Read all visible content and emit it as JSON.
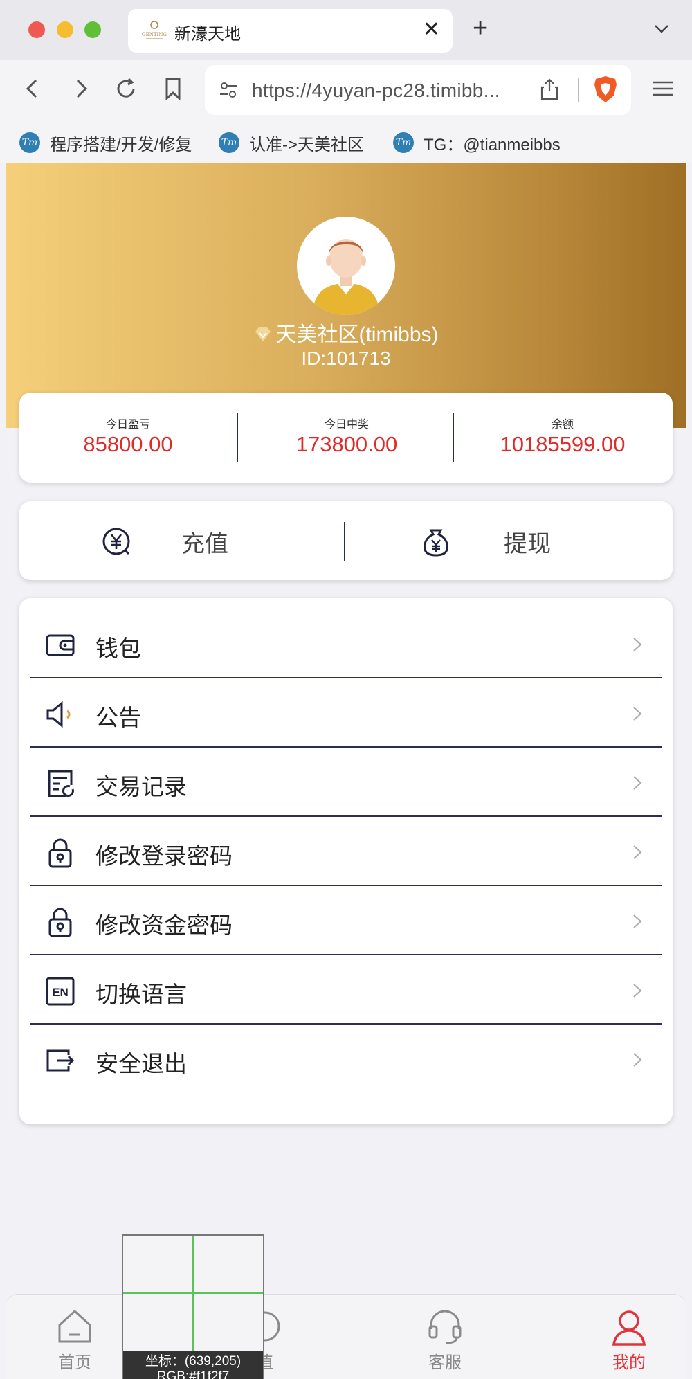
{
  "browser": {
    "tab_title": "新濠天地",
    "url": "https://4yuyan-pc28.timibb...",
    "bookmarks": [
      {
        "label": "程序搭建/开发/修复",
        "icon": "tm-icon"
      },
      {
        "label": "认准->天美社区",
        "icon": "tm-icon"
      },
      {
        "label": "TG：@tianmeibbs",
        "icon": "tm-icon"
      }
    ],
    "tab_logo_text": "GENTING",
    "bookmark_icon_text": "Tm"
  },
  "profile": {
    "name": "天美社区(timibbs)",
    "id": "ID:101713"
  },
  "stats": [
    {
      "label": "今日盈亏",
      "value": "85800.00"
    },
    {
      "label": "今日中奖",
      "value": "173800.00"
    },
    {
      "label": "余额",
      "value": "10185599.00"
    }
  ],
  "actions": {
    "recharge": "充值",
    "withdraw": "提现"
  },
  "menu": [
    {
      "label": "钱包",
      "icon": "wallet-icon"
    },
    {
      "label": "公告",
      "icon": "speaker-icon"
    },
    {
      "label": "交易记录",
      "icon": "transaction-record-icon"
    },
    {
      "label": "修改登录密码",
      "icon": "lock-icon"
    },
    {
      "label": "修改资金密码",
      "icon": "lock-icon"
    },
    {
      "label": "切换语言",
      "icon": "language-en-icon"
    },
    {
      "label": "安全退出",
      "icon": "logout-icon"
    }
  ],
  "language_icon_text": "EN",
  "bottom_nav": [
    {
      "label": "首页",
      "icon": "home-icon",
      "active": false
    },
    {
      "label": "值",
      "icon": "recharge-icon",
      "active": false
    },
    {
      "label": "客服",
      "icon": "headset-icon",
      "active": false
    },
    {
      "label": "我的",
      "icon": "user-icon",
      "active": true
    }
  ],
  "magnifier": {
    "coords": "坐标：(639,205)",
    "rgb": "RGB:#f1f2f7"
  },
  "colors": {
    "accent_red": "#e02b2b",
    "gold_start": "#f5cf7a",
    "gold_end": "#9e6f25",
    "divider": "#2a2f4f"
  }
}
